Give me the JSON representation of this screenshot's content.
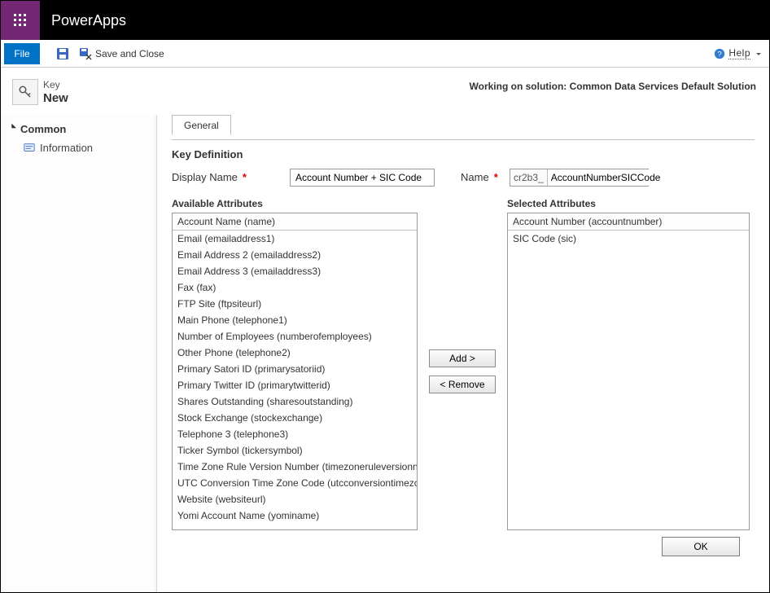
{
  "titlebar": {
    "brand": "PowerApps"
  },
  "ribbon": {
    "file_label": "File",
    "save_and_close_label": "Save and Close",
    "help_label": "Help"
  },
  "header": {
    "entity": "Key",
    "name": "New",
    "solution_text": "Working on solution: Common Data Services Default Solution"
  },
  "sidebar": {
    "section_label": "Common",
    "items": [
      {
        "label": "Information"
      }
    ]
  },
  "tabs": [
    {
      "label": "General"
    }
  ],
  "section_title": "Key Definition",
  "form": {
    "display_name_label": "Display Name",
    "display_name_value": "Account Number + SIC Code",
    "name_label": "Name",
    "name_prefix": "cr2b3_",
    "name_value": "AccountNumberSICCode"
  },
  "available": {
    "label": "Available Attributes",
    "header": "Account Name (name)",
    "items": [
      "Email (emailaddress1)",
      "Email Address 2 (emailaddress2)",
      "Email Address 3 (emailaddress3)",
      "Fax (fax)",
      "FTP Site (ftpsiteurl)",
      "Main Phone (telephone1)",
      "Number of Employees (numberofemployees)",
      "Other Phone (telephone2)",
      "Primary Satori ID (primarysatoriid)",
      "Primary Twitter ID (primarytwitterid)",
      "Shares Outstanding (sharesoutstanding)",
      "Stock Exchange (stockexchange)",
      "Telephone 3 (telephone3)",
      "Ticker Symbol (tickersymbol)",
      "Time Zone Rule Version Number (timezoneruleversionnumber)",
      "UTC Conversion Time Zone Code (utcconversiontimezonecode)",
      "Website (websiteurl)",
      "Yomi Account Name (yominame)"
    ]
  },
  "selected": {
    "label": "Selected Attributes",
    "header": "Account Number (accountnumber)",
    "items": [
      "SIC Code (sic)"
    ]
  },
  "buttons": {
    "add": "Add >",
    "remove": "< Remove",
    "ok": "OK"
  }
}
